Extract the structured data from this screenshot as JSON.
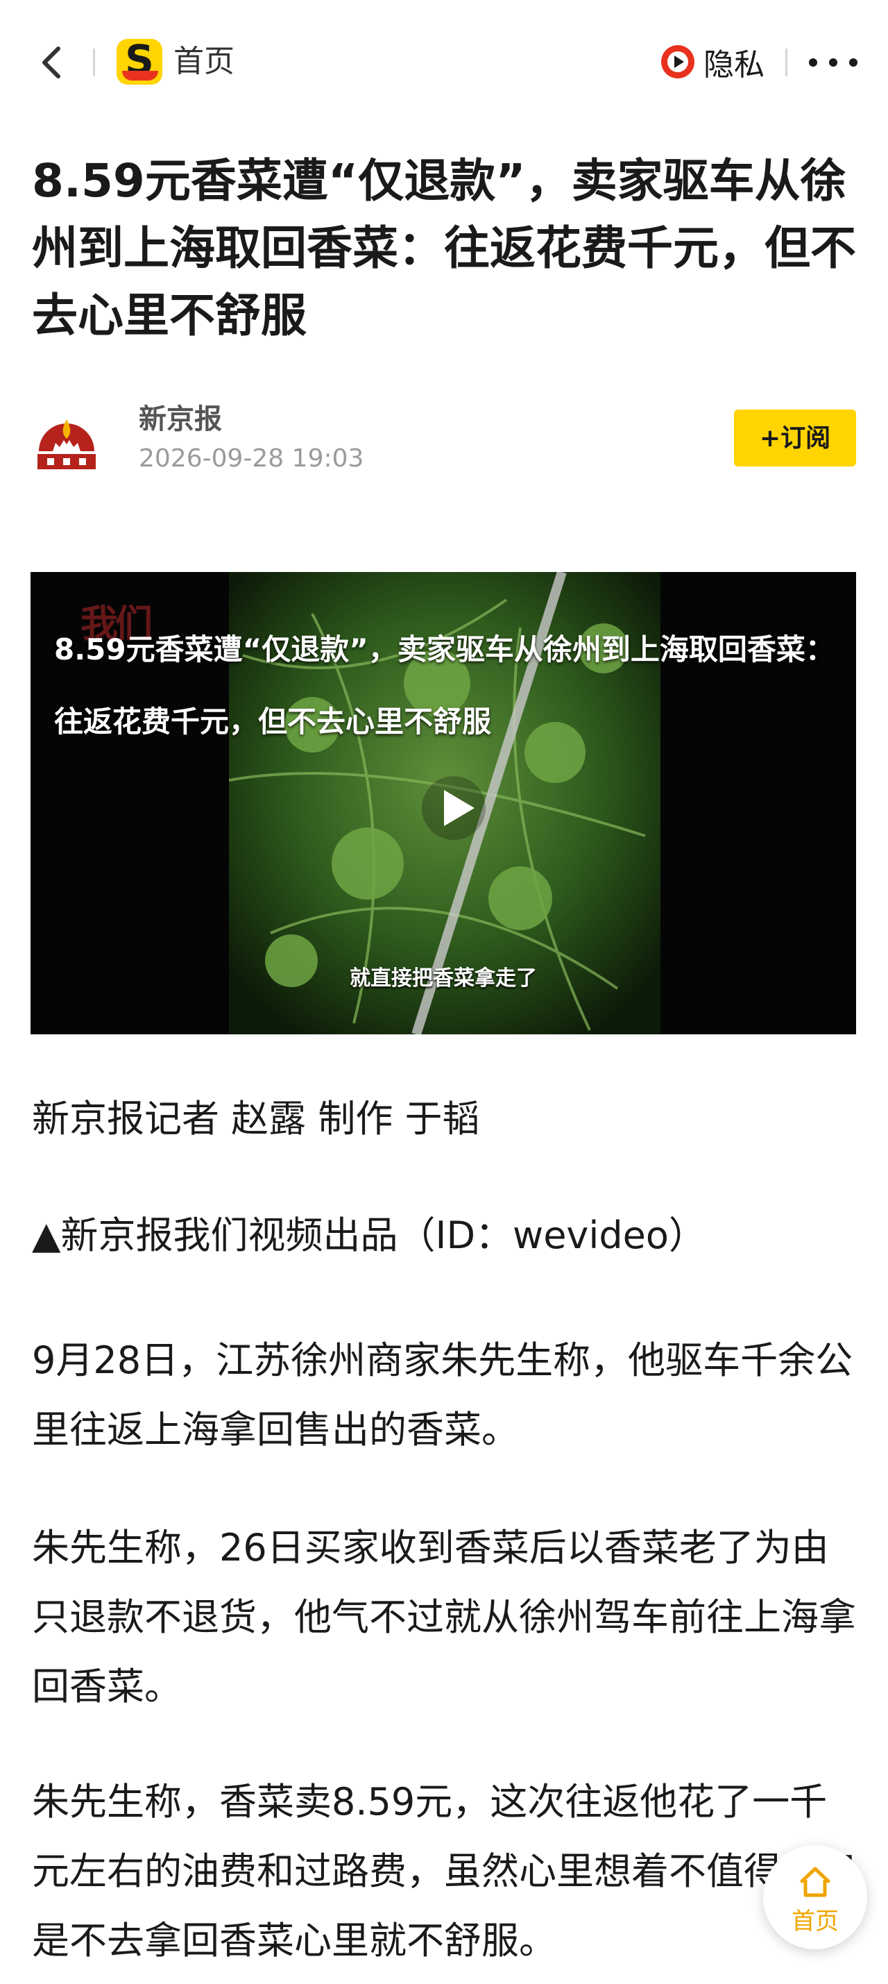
{
  "topbar": {
    "home_label": "首页",
    "privacy_label": "隐私"
  },
  "article": {
    "headline": "8.59元香菜遭“仅退款”，卖家驱车从徐州到上海取回香菜：往返花费千元，但不去心里不舒服",
    "author": "新京报",
    "time": "2026-09-28 19:03",
    "subscribe_label": "+订阅"
  },
  "video": {
    "title": "8.59元香菜遭“仅退款”，卖家驱车从徐州到上海取回香菜：往返花费千元，但不去心里不舒服",
    "caption": "就直接把香菜拿走了",
    "watermark": "我们"
  },
  "paragraphs": [
    "新京报记者 赵露 制作 于韬",
    "▲新京报我们视频出品（ID：wevideo）",
    "9月28日，江苏徐州商家朱先生称，他驱车千余公里往返上海拿回售出的香菜。",
    "朱先生称，26日买家收到香菜后以香菜老了为由只退款不退货，他气不过就从徐州驾车前往上海拿回香菜。",
    "朱先生称，香菜卖8.59元，这次往返他花了一千元左右的油费和过路费，虽然心里想着不值得，但是不去拿回香菜心里就不舒服。"
  ],
  "floating": {
    "home_label": "首页"
  },
  "colors": {
    "accent_yellow": "#ffd400",
    "privacy_red": "#e8321e",
    "float_label": "#f0a500"
  }
}
